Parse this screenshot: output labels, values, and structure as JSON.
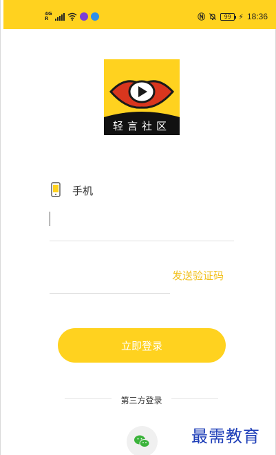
{
  "status_bar": {
    "network_type": "4G",
    "network_sub": "R",
    "battery_level": "99",
    "time": "18:36",
    "background_color": "#ffd21f"
  },
  "app": {
    "logo_text": "轻言社区",
    "brand_color": "#ffd21f",
    "accent_text_color": "#f2c222"
  },
  "login_form": {
    "phone_label": "手机",
    "phone_value": "",
    "code_value": "",
    "send_code_label": "发送验证码",
    "login_button_label": "立即登录"
  },
  "third_party": {
    "label": "第三方登录",
    "providers": [
      {
        "icon": "wechat-icon"
      }
    ]
  },
  "watermark": "最需教育"
}
